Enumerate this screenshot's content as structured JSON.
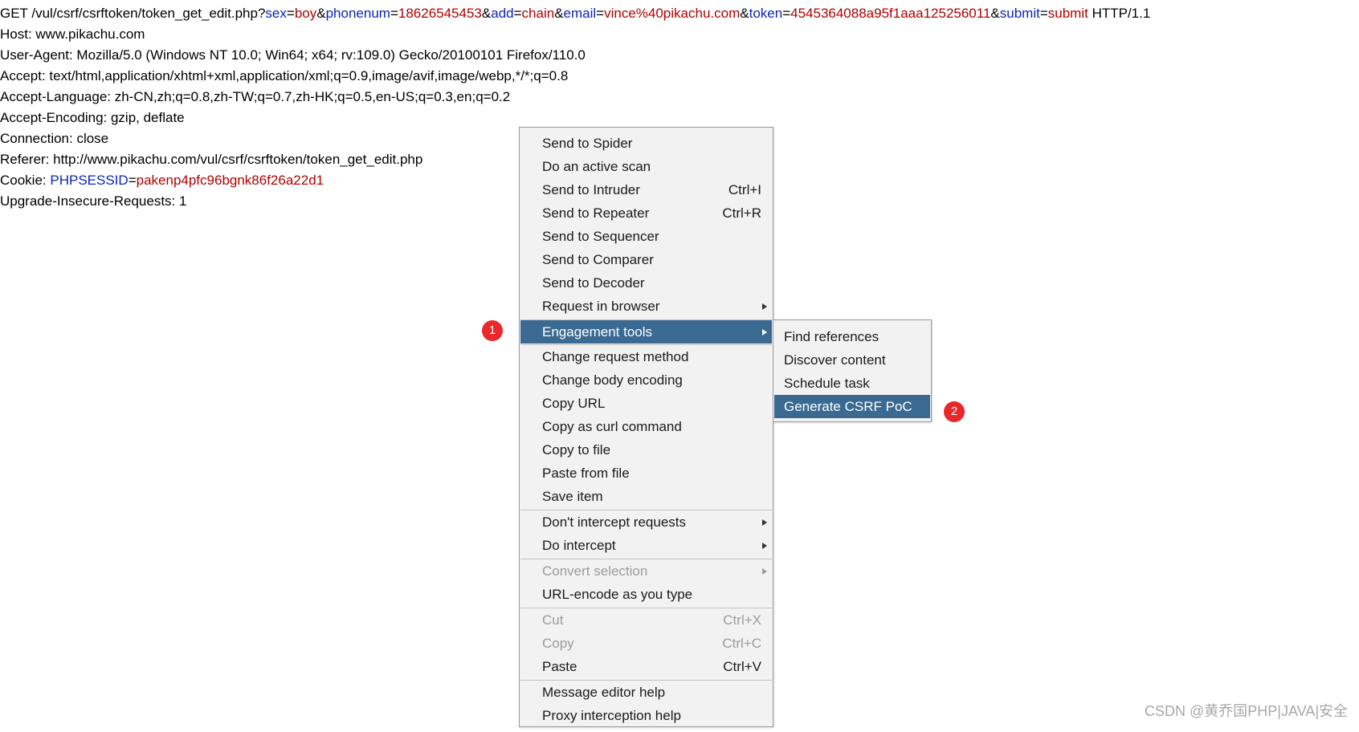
{
  "request": {
    "line1": {
      "prefix": "GET /vul/csrf/csrftoken/token_get_edit.php?",
      "sex_key": "sex",
      "eq1": "=",
      "sex_val": "boy",
      "amp1": "&",
      "phonenum_key": "phonenum",
      "eq2": "=",
      "phonenum_val": "18626545453",
      "amp2": "&",
      "add_key": "add",
      "eq3": "=",
      "add_val": "chain",
      "amp3": "&",
      "email_key": "email",
      "eq4": "=",
      "email_val": "vince%40pikachu.com",
      "amp4": "&",
      "token_key": "token",
      "eq5": "=",
      "token_val": "4545364088a95f1aaa125256011",
      "amp5": "&",
      "submit_key": "submit",
      "eq6": "=",
      "submit_val": "submit",
      "suffix": " HTTP/1.1"
    },
    "host": "Host: www.pikachu.com",
    "user_agent": "User-Agent: Mozilla/5.0 (Windows NT 10.0; Win64; x64; rv:109.0) Gecko/20100101 Firefox/110.0",
    "accept": "Accept: text/html,application/xhtml+xml,application/xml;q=0.9,image/avif,image/webp,*/*;q=0.8",
    "accept_language": "Accept-Language: zh-CN,zh;q=0.8,zh-TW;q=0.7,zh-HK;q=0.5,en-US;q=0.3,en;q=0.2",
    "accept_encoding": "Accept-Encoding: gzip, deflate",
    "connection": "Connection: close",
    "referer": "Referer: http://www.pikachu.com/vul/csrf/csrftoken/token_get_edit.php",
    "cookie": {
      "prefix": "Cookie: ",
      "key": "PHPSESSID",
      "eq": "=",
      "value": "pakenp4pfc96bgnk86f26a22d1"
    },
    "upgrade": "Upgrade-Insecure-Requests: 1"
  },
  "context_menu": {
    "items": [
      {
        "label": "Send to Spider",
        "shortcut": "",
        "submenu": false,
        "state": "normal"
      },
      {
        "label": "Do an active scan",
        "shortcut": "",
        "submenu": false,
        "state": "normal"
      },
      {
        "label": "Send to Intruder",
        "shortcut": "Ctrl+I",
        "submenu": false,
        "state": "normal"
      },
      {
        "label": "Send to Repeater",
        "shortcut": "Ctrl+R",
        "submenu": false,
        "state": "normal"
      },
      {
        "label": "Send to Sequencer",
        "shortcut": "",
        "submenu": false,
        "state": "normal"
      },
      {
        "label": "Send to Comparer",
        "shortcut": "",
        "submenu": false,
        "state": "normal"
      },
      {
        "label": "Send to Decoder",
        "shortcut": "",
        "submenu": false,
        "state": "normal"
      },
      {
        "label": "Request in browser",
        "shortcut": "",
        "submenu": true,
        "state": "normal"
      },
      {
        "label": "Engagement tools",
        "shortcut": "",
        "submenu": true,
        "state": "highlighted"
      },
      {
        "label": "Change request method",
        "shortcut": "",
        "submenu": false,
        "state": "normal"
      },
      {
        "label": "Change body encoding",
        "shortcut": "",
        "submenu": false,
        "state": "normal"
      },
      {
        "label": "Copy URL",
        "shortcut": "",
        "submenu": false,
        "state": "normal"
      },
      {
        "label": "Copy as curl command",
        "shortcut": "",
        "submenu": false,
        "state": "normal"
      },
      {
        "label": "Copy to file",
        "shortcut": "",
        "submenu": false,
        "state": "normal"
      },
      {
        "label": "Paste from file",
        "shortcut": "",
        "submenu": false,
        "state": "normal"
      },
      {
        "label": "Save item",
        "shortcut": "",
        "submenu": false,
        "state": "normal"
      },
      {
        "label": "Don't intercept requests",
        "shortcut": "",
        "submenu": true,
        "state": "normal"
      },
      {
        "label": "Do intercept",
        "shortcut": "",
        "submenu": true,
        "state": "normal"
      },
      {
        "label": "Convert selection",
        "shortcut": "",
        "submenu": true,
        "state": "disabled"
      },
      {
        "label": "URL-encode as you type",
        "shortcut": "",
        "submenu": false,
        "state": "normal"
      },
      {
        "label": "Cut",
        "shortcut": "Ctrl+X",
        "submenu": false,
        "state": "disabled"
      },
      {
        "label": "Copy",
        "shortcut": "Ctrl+C",
        "submenu": false,
        "state": "disabled"
      },
      {
        "label": "Paste",
        "shortcut": "Ctrl+V",
        "submenu": false,
        "state": "normal"
      },
      {
        "label": "Message editor help",
        "shortcut": "",
        "submenu": false,
        "state": "normal"
      },
      {
        "label": "Proxy interception help",
        "shortcut": "",
        "submenu": false,
        "state": "normal"
      }
    ]
  },
  "engagement_submenu": {
    "items": [
      {
        "label": "Find references",
        "state": "normal"
      },
      {
        "label": "Discover content",
        "state": "normal"
      },
      {
        "label": "Schedule task",
        "state": "normal"
      },
      {
        "label": "Generate CSRF PoC",
        "state": "highlighted"
      }
    ]
  },
  "badges": {
    "step1": "1",
    "step2": "2"
  },
  "watermark": "CSDN @黄乔国PHP|JAVA|安全",
  "colors": {
    "param_key": "#0b24b8",
    "param_value": "#b00000",
    "menu_highlight": "#3a6a92",
    "badge": "#e8282b"
  }
}
